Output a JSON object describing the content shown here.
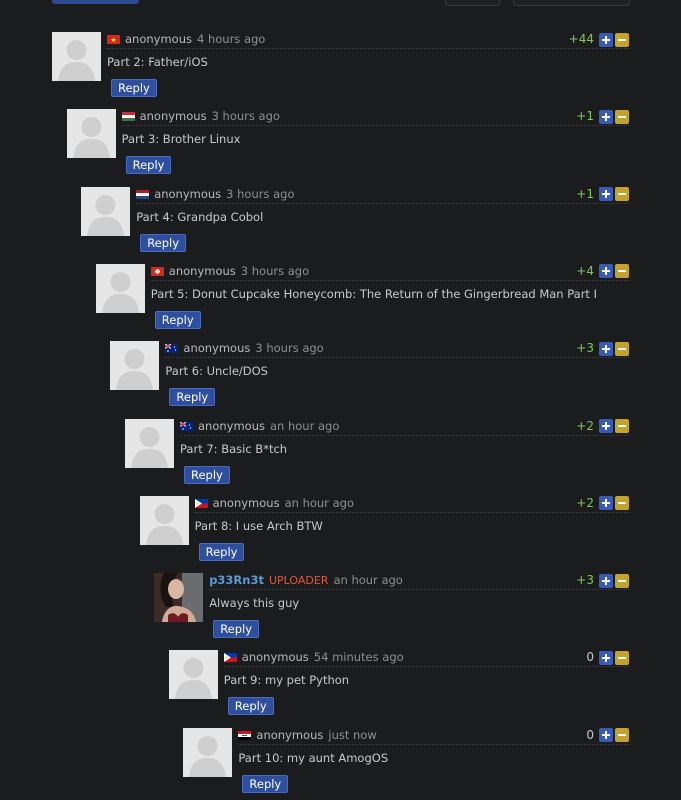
{
  "comments": [
    {
      "author": "anonymous",
      "time": "4 hours ago",
      "score": "+44",
      "text": "Part 2: Father/iOS",
      "reply": "Reply",
      "flag": "vn-flag-icon"
    },
    {
      "author": "anonymous",
      "time": "3 hours ago",
      "score": "+1",
      "text": "Part 3: Brother Linux",
      "reply": "Reply",
      "flag": "hu-flag-icon"
    },
    {
      "author": "anonymous",
      "time": "3 hours ago",
      "score": "+1",
      "text": "Part 4: Grandpa Cobol",
      "reply": "Reply",
      "flag": "nl-flag-icon"
    },
    {
      "author": "anonymous",
      "time": "3 hours ago",
      "score": "+4",
      "text": "Part 5: Donut Cupcake Honeycomb: The Return of the Gingerbread Man Part I",
      "reply": "Reply",
      "flag": "ch-flag-icon"
    },
    {
      "author": "anonymous",
      "time": "3 hours ago",
      "score": "+3",
      "text": "Part 6: Uncle/DOS",
      "reply": "Reply",
      "flag": "au-flag-icon"
    },
    {
      "author": "anonymous",
      "time": "an hour ago",
      "score": "+2",
      "text": "Part 7: Basic B*tch",
      "reply": "Reply",
      "flag": "au-flag-icon"
    },
    {
      "author": "anonymous",
      "time": "an hour ago",
      "score": "+2",
      "text": "Part 8: I use Arch BTW",
      "reply": "Reply",
      "flag": "ph-flag-icon"
    },
    {
      "author": "p33Rn3t",
      "badge": "UPLOADER",
      "time": "an hour ago",
      "score": "+3",
      "text": "Always this guy",
      "reply": "Reply",
      "flag": ""
    },
    {
      "author": "anonymous",
      "time": "54 minutes ago",
      "score": "0",
      "text": "Part 9: my pet Python",
      "reply": "Reply",
      "flag": "ph-flag-icon"
    },
    {
      "author": "anonymous",
      "time": "just now",
      "score": "0",
      "text": "Part 10: my aunt AmogOS",
      "reply": "Reply",
      "flag": "iq-flag-icon"
    }
  ],
  "colors": {
    "positive_score": "#7fcb4a",
    "uploader_badge": "#e0583a",
    "upvote": "#3a5bb5",
    "downvote": "#c2a32b",
    "reply_button": "#2e4f9e"
  }
}
